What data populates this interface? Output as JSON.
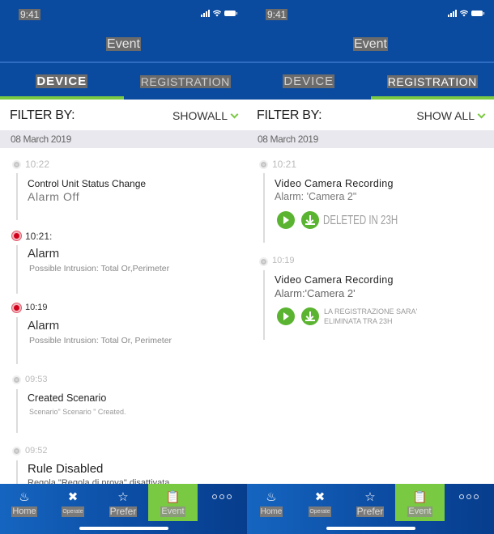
{
  "status_bar": {
    "time": "9:41"
  },
  "header": {
    "title": "Event"
  },
  "tabs": [
    {
      "label": "DEVICE"
    },
    {
      "label": "REGISTRATION"
    }
  ],
  "filter": {
    "label": "FILTER BY:",
    "value_left": "SHOWALL",
    "value_right": "SHOW ALL"
  },
  "date": "08 March 2019",
  "device_events": [
    {
      "time": "10:22",
      "status": "normal",
      "title": "Control Unit Status Change",
      "subtitle": "Alarm Off"
    },
    {
      "time": "10:21:",
      "status": "alarm",
      "title": "Alarm",
      "subtitle": "Possible Intrusion: Total Or,Perimeter"
    },
    {
      "time": "10:19",
      "status": "alarm",
      "title": "Alarm",
      "subtitle": "Possible Intrusion: Total Or, Perimeter"
    },
    {
      "time": "09:53",
      "status": "normal",
      "title": "Created Scenario",
      "subtitle": "Scenario\" Scenario \" Created."
    },
    {
      "time": "09:52",
      "status": "normal",
      "title": "Rule Disabled",
      "subtitle": "Regola \"Regola di prova\" disattivata"
    }
  ],
  "recording_events": [
    {
      "time": "10:21",
      "title": "Video Camera Recording",
      "subtitle": "Alarm: 'Camera 2\"",
      "note": "DELETED IN 23H"
    },
    {
      "time": "10:19",
      "title": "Video Camera Recording",
      "subtitle": "Alarm:'Camera 2'",
      "note_line1": "LA REGISTRAZIONE SARA'",
      "note_line2": "ELIMINATA TRA 23H"
    }
  ],
  "nav": [
    {
      "label": "Home",
      "icon": "home-hand-icon"
    },
    {
      "label": "Operate",
      "icon": "tools-icon"
    },
    {
      "label": "Prefer",
      "icon": "star-icon"
    },
    {
      "label": "Event",
      "icon": "clipboard-icon",
      "active": true
    },
    {
      "label": "",
      "icon": "more-icon"
    }
  ],
  "colors": {
    "primary": "#0a4a9f",
    "accent": "#7ac943",
    "alarm": "#d0021b",
    "action": "#5bb431"
  }
}
